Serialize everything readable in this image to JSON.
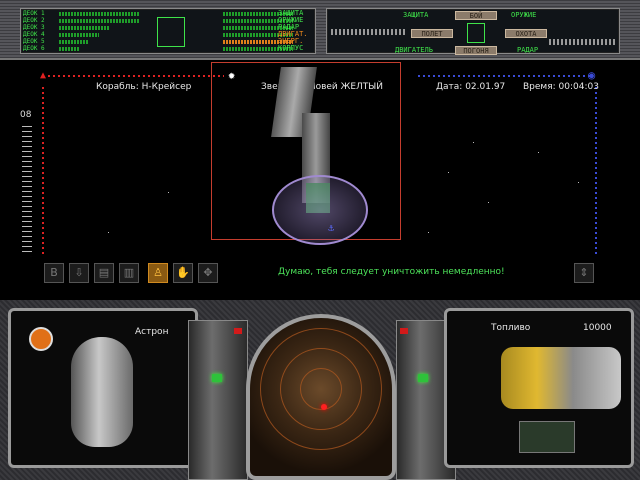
{
  "top_console": {
    "decks": [
      "ДЕОК 1",
      "ДЕОК 2",
      "ДЕОК 3",
      "ДЕОК 4",
      "ДЕОК 5",
      "ДЕОК 6"
    ],
    "systems": [
      "ЗАЩИТА",
      "ОРУЖИЕ",
      "РАДАР",
      "ДВИГАТ.",
      "ЭНЕРГ.",
      "КОРПУС"
    ],
    "status_left": [
      "ЗАЩИТА",
      "ДВИГАТЕЛЬ"
    ],
    "status_right": [
      "ОРУЖИЕ",
      "РАДАР"
    ],
    "mode_buttons": {
      "battle": "БОЙ",
      "flight": "ПОЛЕТ",
      "hunt": "ОХОТА",
      "chase": "ПОГОНЯ"
    }
  },
  "hud": {
    "ship": "Корабль: Н-Крейсер",
    "star": "Звезда: α Ловей ЖЕЛТЫЙ",
    "date": "Дата: 02.01.97",
    "time": "Время: 00:04:03",
    "speed": "08",
    "message": "Думаю, тебя следует уничтожить немедленно!",
    "icons": [
      {
        "name": "b-icon",
        "glyph": "B"
      },
      {
        "name": "import-icon",
        "glyph": "⇩"
      },
      {
        "name": "card-icon",
        "glyph": "▤"
      },
      {
        "name": "cargo-icon",
        "glyph": "▥"
      },
      {
        "name": "pilot-icon",
        "glyph": "♙"
      },
      {
        "name": "hand-icon",
        "glyph": "✋"
      },
      {
        "name": "move-icon",
        "glyph": "✥"
      },
      {
        "name": "temperature-icon",
        "glyph": "t°"
      }
    ]
  },
  "cockpit": {
    "pilot_name": "Астрон",
    "fuel_label": "Топливо",
    "fuel_value": "10000"
  }
}
